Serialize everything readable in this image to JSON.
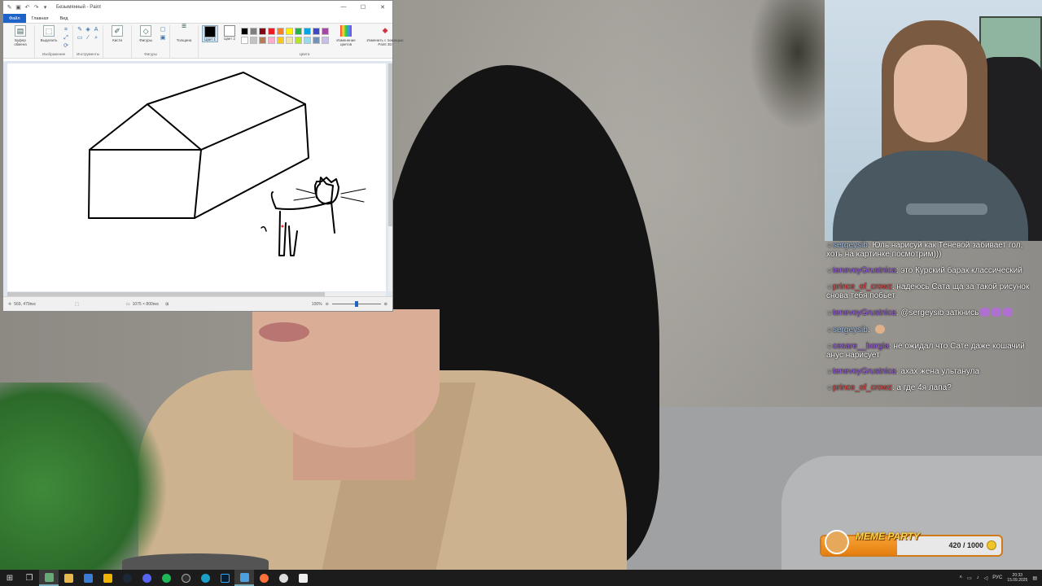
{
  "paint": {
    "title": "Безымянный - Paint",
    "menu": [
      "Файл",
      "Главная",
      "Вид"
    ],
    "ribbon": {
      "clipboard": {
        "label": "Буфер обмена",
        "button": "Буфер обмена"
      },
      "image": {
        "label": "Изображение",
        "select": "Выделить"
      },
      "tools": {
        "label": "Инструменты"
      },
      "brushes": "Кисти",
      "shapes": {
        "label": "Фигуры",
        "button": "Фигуры"
      },
      "thickness": "Толщина",
      "color1": "Цвет 1",
      "color2": "Цвет 2",
      "colors_label": "Цвета",
      "edit_colors": "Изменение цветов",
      "paint3d": "Изменить с помощью Paint 3D"
    },
    "palette": [
      "#000000",
      "#7f7f7f",
      "#880015",
      "#ed1c24",
      "#ff7f27",
      "#fff200",
      "#22b14c",
      "#00a2e8",
      "#3f48cc",
      "#a349a4",
      "#ffffff",
      "#c3c3c3",
      "#b97a57",
      "#ffaec9",
      "#ffc90e",
      "#efe4b0",
      "#b5e61d",
      "#99d9ea",
      "#7092be",
      "#c8bfe7"
    ],
    "status": {
      "cursor": "569, 479пкс",
      "canvas_size": "1075 × 800пкс",
      "zoom": "100%"
    }
  },
  "chat": [
    {
      "user": "sergeysib",
      "text": "Юль нарисуй как Теневой забивает гол, хоть на картинке посмотрим)))"
    },
    {
      "user": "tenevoyGrustnica",
      "text": "это Курский барак классический"
    },
    {
      "user": "prince_of_crowz",
      "text": "надеюсь Сата ща за такой рисунок снова тебя побьет"
    },
    {
      "user": "tenevoyGrustnica",
      "text": "@sergeysib заткнись"
    },
    {
      "user": "sergeysib",
      "text": ""
    },
    {
      "user": "cesare__borgia",
      "text": "не ожидал что Сате даже кошачий анус нарисует"
    },
    {
      "user": "tenevoyGrustnica",
      "text": "ахах жена ультанула"
    },
    {
      "user": "prince_of_crowz",
      "text": "а где 4я лапа?"
    }
  ],
  "goal": {
    "title": "MEME PARTY",
    "count": "420 / 1000",
    "progress": 0.42
  },
  "taskbar": {
    "lang": "РУС",
    "time": "20:33",
    "date": "15.09.2025"
  }
}
